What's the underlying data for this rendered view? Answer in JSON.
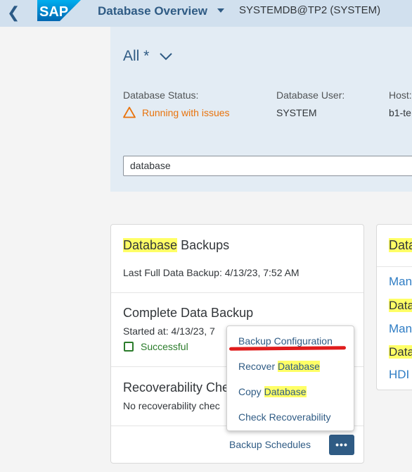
{
  "shell": {
    "back_glyph": "❮",
    "logo_text": "SAP",
    "app_title": "Database Overview",
    "system_id": "SYSTEMDB@TP2 (SYSTEM)"
  },
  "header": {
    "variant": "All *",
    "status_label": "Database Status:",
    "status_value": "Running with issues",
    "user_label": "Database User:",
    "user_value": "SYSTEM",
    "host_label": "Host:",
    "host_value": "b1-te",
    "search_value": "database"
  },
  "backup_card": {
    "title_highlight": "Database",
    "title_rest": " Backups",
    "last_full": "Last Full Data Backup: 4/13/23, 7:52 AM",
    "complete_title": "Complete Data Backup",
    "started_at": "Started at: 4/13/23, 7",
    "success": "Successful",
    "recover_title": "Recoverability Che",
    "recover_text": "No recoverability chec",
    "footer_link": "Backup Schedules",
    "more_label": "•••"
  },
  "right_card": {
    "title_highlight": "Data",
    "links": [
      {
        "text": "Man",
        "highlight": false
      },
      {
        "text": "Data",
        "highlight": true
      },
      {
        "text": "Man",
        "highlight": false
      },
      {
        "text": "Data",
        "highlight": true
      },
      {
        "text": "HDI",
        "highlight": false
      }
    ]
  },
  "menu": {
    "items": [
      {
        "pre": "Backup Configuration",
        "hl": ""
      },
      {
        "pre": "Recover ",
        "hl": "Database"
      },
      {
        "pre": "Copy ",
        "hl": "Database"
      },
      {
        "pre": "Check Recoverability",
        "hl": ""
      }
    ]
  },
  "colors": {
    "shell_bg": "#d1e0ee",
    "accent": "#2f5b84",
    "warning": "#e9730c",
    "success": "#2b7c2b",
    "highlight": "#ffff66",
    "annotation": "#e01c1c"
  }
}
